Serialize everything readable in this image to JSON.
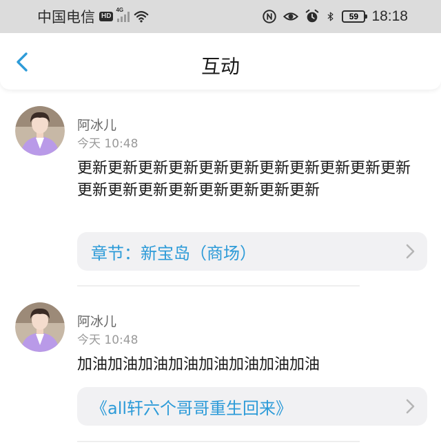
{
  "status_bar": {
    "carrier": "中国电信",
    "hd_badge": "HD",
    "network": "4G",
    "battery": "59",
    "battery_level": 0.59,
    "time": "18:18",
    "icons": [
      "signal-icon",
      "wifi-icon",
      "nfc-icon",
      "eye-icon",
      "alarm-icon",
      "bluetooth-icon",
      "battery-icon"
    ]
  },
  "header": {
    "title": "互动",
    "back_icon": "chevron-left-icon"
  },
  "colors": {
    "accent": "#2d9bd8",
    "status_bar_bg": "#dcdcdc",
    "card_bg": "#f1f1f3"
  },
  "feed": {
    "items": [
      {
        "username": "阿冰儿",
        "time": "今天 10:48",
        "text": "更新更新更新更新更新更新更新更新更新更新更新更新更新更新更新更新更新更新更新",
        "link": "章节：新宝岛（商场）"
      },
      {
        "username": "阿冰儿",
        "time": "今天 10:48",
        "text": "加油加油加油加油加油加油加油加油",
        "link": "《all轩六个哥哥重生回来》"
      }
    ]
  }
}
